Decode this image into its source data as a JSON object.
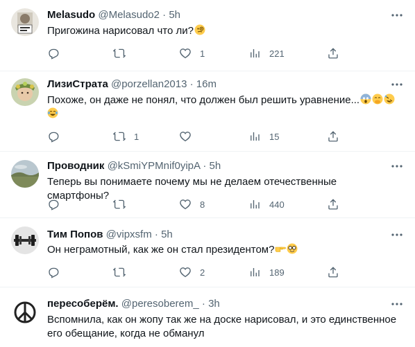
{
  "tweets": [
    {
      "name": "Melasudo",
      "handle": "@Melasudo2",
      "sep": "·",
      "time": "5h",
      "text": "Пригожина нарисовал что ли?",
      "emojis": [
        "face-with-monocle"
      ],
      "replies": "",
      "retweets": "",
      "likes": "1",
      "views": "221"
    },
    {
      "name": "ЛизиСтрата",
      "handle": "@porzellan2013",
      "sep": "·",
      "time": "16m",
      "text": "Похоже, он даже не понял, что должен был решить уравнение...",
      "emojis": [
        "face-screaming",
        "face-hand-over-mouth",
        "rolling-laughing",
        "joy-tears"
      ],
      "replies": "",
      "retweets": "1",
      "likes": "",
      "views": "15"
    },
    {
      "name": "Проводник",
      "handle": "@kSmiYPMnif0yipA",
      "sep": "·",
      "time": "5h",
      "text": "Теперь вы понимаете почему мы не делаем отечественные смартфоны?",
      "emojis": [],
      "replies": "",
      "retweets": "",
      "likes": "8",
      "views": "440"
    },
    {
      "name": "Тим Попов",
      "handle": "@vipxsfm",
      "sep": "·",
      "time": "5h",
      "text": "Он неграмотный, как же он стал президентом?",
      "emojis": [
        "pointing-right",
        "nerd-face"
      ],
      "replies": "",
      "retweets": "",
      "likes": "2",
      "views": "189"
    },
    {
      "name": "пересоберём.",
      "handle": "@peresoberem_",
      "sep": "·",
      "time": "3h",
      "text_line1": "Вспомнила, как он жопу так же на доске нарисовал, и это единственное",
      "text_line2": "его обещание, когда не обманул",
      "emojis": []
    }
  ],
  "colors": {
    "text": "#0f1419",
    "secondary": "#536471",
    "divider": "#eff3f4"
  }
}
